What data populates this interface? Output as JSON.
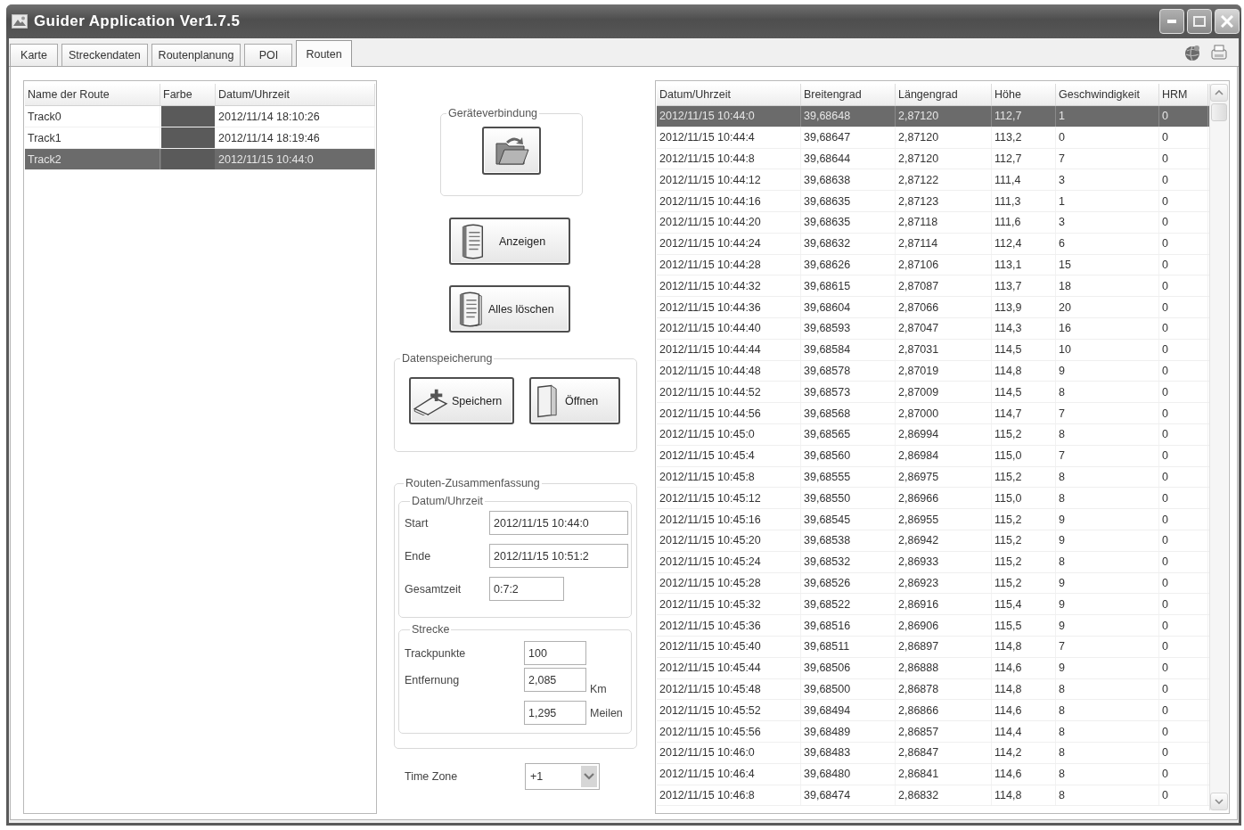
{
  "window": {
    "title": "Guider Application Ver1.7.5"
  },
  "tabs": [
    {
      "label": "Karte",
      "selected": false
    },
    {
      "label": "Streckendaten",
      "selected": false
    },
    {
      "label": "Routenplanung",
      "selected": false
    },
    {
      "label": "POI",
      "selected": false
    },
    {
      "label": "Routen",
      "selected": true
    }
  ],
  "routes": {
    "columns": [
      "Name der Route",
      "Farbe",
      "Datum/Uhrzeit"
    ],
    "rows": [
      {
        "name": "Track0",
        "color": "#5a5a5a",
        "datetime": "2012/11/14 18:10:26",
        "selected": false
      },
      {
        "name": "Track1",
        "color": "#5a5a5a",
        "datetime": "2012/11/14 18:19:46",
        "selected": false
      },
      {
        "name": "Track2",
        "color": "#5a5a5a",
        "datetime": "2012/11/15 10:44:0",
        "selected": true
      }
    ]
  },
  "device_connection": {
    "title": "Geräteverbindung"
  },
  "show_button": {
    "label": "Anzeigen"
  },
  "clear_all_button": {
    "label": "Alles löschen"
  },
  "data_storage": {
    "title": "Datenspeicherung",
    "save_button": {
      "label": "Speichern"
    },
    "open_button": {
      "label": "Öffnen"
    }
  },
  "summary": {
    "title": "Routen-Zusammenfassung",
    "datetime_group": {
      "title": "Datum/Uhrzeit",
      "start": {
        "label": "Start",
        "value": "2012/11/15 10:44:0"
      },
      "end": {
        "label": "Ende",
        "value": "2012/11/15 10:51:2"
      },
      "total_time": {
        "label": "Gesamtzeit",
        "value": "0:7:2"
      }
    },
    "distance_group": {
      "title": "Strecke",
      "trackpoints": {
        "label": "Trackpunkte",
        "value": "100"
      },
      "distance": {
        "label": "Entfernung",
        "km_value": "2,085",
        "km_unit": "Km",
        "miles_value": "1,295",
        "miles_unit": "Meilen"
      }
    }
  },
  "time_zone": {
    "label": "Time Zone",
    "value": "+1"
  },
  "track_points": {
    "columns": [
      "Datum/Uhrzeit",
      "Breitengrad",
      "Längengrad",
      "Höhe",
      "Geschwindigkeit",
      "HRM"
    ],
    "rows": [
      {
        "cells": [
          "2012/11/15 10:44:0",
          "39,68648",
          "2,87120",
          "112,7",
          "1",
          "0"
        ],
        "selected": true
      },
      {
        "cells": [
          "2012/11/15 10:44:4",
          "39,68647",
          "2,87120",
          "113,2",
          "0",
          "0"
        ],
        "selected": false
      },
      {
        "cells": [
          "2012/11/15 10:44:8",
          "39,68644",
          "2,87120",
          "112,7",
          "7",
          "0"
        ],
        "selected": false
      },
      {
        "cells": [
          "2012/11/15 10:44:12",
          "39,68638",
          "2,87122",
          "111,4",
          "3",
          "0"
        ],
        "selected": false
      },
      {
        "cells": [
          "2012/11/15 10:44:16",
          "39,68635",
          "2,87123",
          "111,3",
          "1",
          "0"
        ],
        "selected": false
      },
      {
        "cells": [
          "2012/11/15 10:44:20",
          "39,68635",
          "2,87118",
          "111,6",
          "3",
          "0"
        ],
        "selected": false
      },
      {
        "cells": [
          "2012/11/15 10:44:24",
          "39,68632",
          "2,87114",
          "112,4",
          "6",
          "0"
        ],
        "selected": false
      },
      {
        "cells": [
          "2012/11/15 10:44:28",
          "39,68626",
          "2,87106",
          "113,1",
          "15",
          "0"
        ],
        "selected": false
      },
      {
        "cells": [
          "2012/11/15 10:44:32",
          "39,68615",
          "2,87087",
          "113,7",
          "18",
          "0"
        ],
        "selected": false
      },
      {
        "cells": [
          "2012/11/15 10:44:36",
          "39,68604",
          "2,87066",
          "113,9",
          "20",
          "0"
        ],
        "selected": false
      },
      {
        "cells": [
          "2012/11/15 10:44:40",
          "39,68593",
          "2,87047",
          "114,3",
          "16",
          "0"
        ],
        "selected": false
      },
      {
        "cells": [
          "2012/11/15 10:44:44",
          "39,68584",
          "2,87031",
          "114,5",
          "10",
          "0"
        ],
        "selected": false
      },
      {
        "cells": [
          "2012/11/15 10:44:48",
          "39,68578",
          "2,87019",
          "114,8",
          "9",
          "0"
        ],
        "selected": false
      },
      {
        "cells": [
          "2012/11/15 10:44:52",
          "39,68573",
          "2,87009",
          "114,5",
          "8",
          "0"
        ],
        "selected": false
      },
      {
        "cells": [
          "2012/11/15 10:44:56",
          "39,68568",
          "2,87000",
          "114,7",
          "7",
          "0"
        ],
        "selected": false
      },
      {
        "cells": [
          "2012/11/15 10:45:0",
          "39,68565",
          "2,86994",
          "115,2",
          "8",
          "0"
        ],
        "selected": false
      },
      {
        "cells": [
          "2012/11/15 10:45:4",
          "39,68560",
          "2,86984",
          "115,0",
          "7",
          "0"
        ],
        "selected": false
      },
      {
        "cells": [
          "2012/11/15 10:45:8",
          "39,68555",
          "2,86975",
          "115,2",
          "8",
          "0"
        ],
        "selected": false
      },
      {
        "cells": [
          "2012/11/15 10:45:12",
          "39,68550",
          "2,86966",
          "115,0",
          "8",
          "0"
        ],
        "selected": false
      },
      {
        "cells": [
          "2012/11/15 10:45:16",
          "39,68545",
          "2,86955",
          "115,2",
          "9",
          "0"
        ],
        "selected": false
      },
      {
        "cells": [
          "2012/11/15 10:45:20",
          "39,68538",
          "2,86942",
          "115,2",
          "9",
          "0"
        ],
        "selected": false
      },
      {
        "cells": [
          "2012/11/15 10:45:24",
          "39,68532",
          "2,86933",
          "115,2",
          "8",
          "0"
        ],
        "selected": false
      },
      {
        "cells": [
          "2012/11/15 10:45:28",
          "39,68526",
          "2,86923",
          "115,2",
          "9",
          "0"
        ],
        "selected": false
      },
      {
        "cells": [
          "2012/11/15 10:45:32",
          "39,68522",
          "2,86916",
          "115,4",
          "9",
          "0"
        ],
        "selected": false
      },
      {
        "cells": [
          "2012/11/15 10:45:36",
          "39,68516",
          "2,86906",
          "115,5",
          "9",
          "0"
        ],
        "selected": false
      },
      {
        "cells": [
          "2012/11/15 10:45:40",
          "39,68511",
          "2,86897",
          "114,8",
          "7",
          "0"
        ],
        "selected": false
      },
      {
        "cells": [
          "2012/11/15 10:45:44",
          "39,68506",
          "2,86888",
          "114,6",
          "9",
          "0"
        ],
        "selected": false
      },
      {
        "cells": [
          "2012/11/15 10:45:48",
          "39,68500",
          "2,86878",
          "114,8",
          "8",
          "0"
        ],
        "selected": false
      },
      {
        "cells": [
          "2012/11/15 10:45:52",
          "39,68494",
          "2,86866",
          "114,6",
          "8",
          "0"
        ],
        "selected": false
      },
      {
        "cells": [
          "2012/11/15 10:45:56",
          "39,68489",
          "2,86857",
          "114,4",
          "8",
          "0"
        ],
        "selected": false
      },
      {
        "cells": [
          "2012/11/15 10:46:0",
          "39,68483",
          "2,86847",
          "114,2",
          "8",
          "0"
        ],
        "selected": false
      },
      {
        "cells": [
          "2012/11/15 10:46:4",
          "39,68480",
          "2,86841",
          "114,6",
          "8",
          "0"
        ],
        "selected": false
      },
      {
        "cells": [
          "2012/11/15 10:46:8",
          "39,68474",
          "2,86832",
          "114,8",
          "8",
          "0"
        ],
        "selected": false
      }
    ]
  }
}
